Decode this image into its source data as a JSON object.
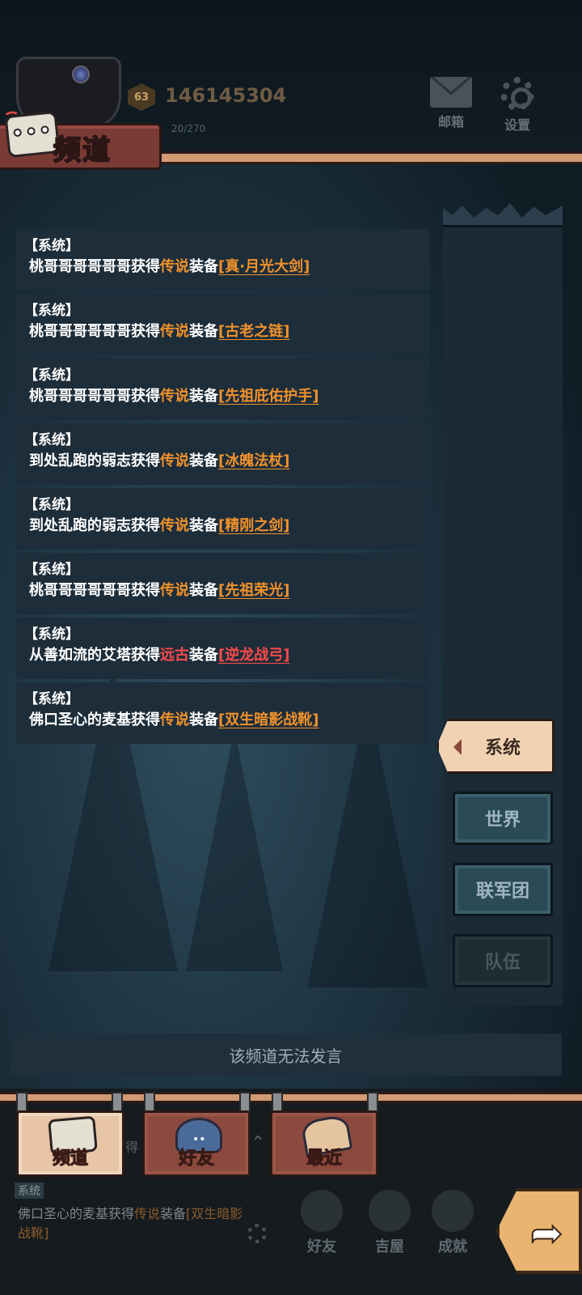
{
  "header": {
    "level": "63",
    "power": "146145304",
    "exp": "20/270",
    "mail_label": "邮箱",
    "settings_label": "设置",
    "title": "频道"
  },
  "messages": [
    {
      "tag": "【系统】",
      "player": "桃哥哥哥哥哥哥获得",
      "rarity": "传说",
      "mid": "装备",
      "item": "[真·月光大剑]",
      "rarity_color": "#f0912b"
    },
    {
      "tag": "【系统】",
      "player": "桃哥哥哥哥哥哥获得",
      "rarity": "传说",
      "mid": "装备",
      "item": "[古老之链]",
      "rarity_color": "#f0912b"
    },
    {
      "tag": "【系统】",
      "player": "桃哥哥哥哥哥哥获得",
      "rarity": "传说",
      "mid": "装备",
      "item": "[先祖庇佑护手]",
      "rarity_color": "#f0912b"
    },
    {
      "tag": "【系统】",
      "player": "到处乱跑的弱志获得",
      "rarity": "传说",
      "mid": "装备",
      "item": "[冰魄法杖]",
      "rarity_color": "#f0912b"
    },
    {
      "tag": "【系统】",
      "player": "到处乱跑的弱志获得",
      "rarity": "传说",
      "mid": "装备",
      "item": "[精刚之剑]",
      "rarity_color": "#f0912b"
    },
    {
      "tag": "【系统】",
      "player": "桃哥哥哥哥哥哥获得",
      "rarity": "传说",
      "mid": "装备",
      "item": "[先祖荣光]",
      "rarity_color": "#f0912b"
    },
    {
      "tag": "【系统】",
      "player": "从善如流的艾塔获得",
      "rarity": "远古",
      "mid": "装备",
      "item": "[逆龙战弓]",
      "rarity_color": "#ff4a4a"
    },
    {
      "tag": "【系统】",
      "player": "佛口圣心的麦基获得",
      "rarity": "传说",
      "mid": "装备",
      "item": "[双生暗影战靴]",
      "rarity_color": "#f0912b"
    }
  ],
  "channels": {
    "system": "系统",
    "world": "世界",
    "legion": "联军团",
    "team": "队伍",
    "active": "system"
  },
  "input": {
    "placeholder": "该频道无法发言"
  },
  "bottom_tabs": {
    "channel": "频道",
    "friends": "好友",
    "recent": "最近"
  },
  "mini_chat": {
    "tag": "系统",
    "text_prefix": "佛口圣心的麦基获得",
    "rarity": "传说",
    "mid": "装备",
    "item": "[双生暗影战靴]",
    "ghost": "得"
  },
  "nav": {
    "friends": "好友",
    "house": "吉屋",
    "achievement": "成就"
  },
  "colors": {
    "legend": "#f0912b",
    "ancient": "#ff4a4a",
    "ribbon": "#d29a72",
    "tab_red": "#8c4a3e"
  }
}
